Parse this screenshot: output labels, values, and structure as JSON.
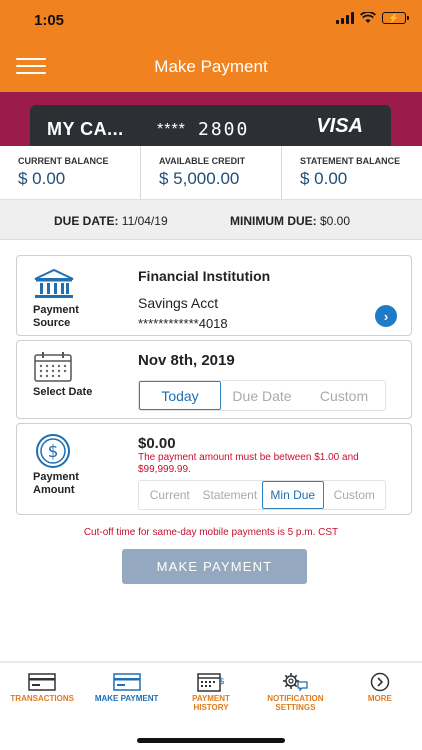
{
  "status_bar": {
    "time": "1:05",
    "battery": "⚡"
  },
  "header": {
    "title": "Make Payment"
  },
  "card": {
    "name": "MY CA...",
    "mask": "****",
    "last4": "2800",
    "brand": "VISA"
  },
  "balances": [
    {
      "label": "CURRENT BALANCE",
      "value": "$ 0.00"
    },
    {
      "label": "AVAILABLE CREDIT",
      "value": "$ 5,000.00"
    },
    {
      "label": "STATEMENT BALANCE",
      "value": "$ 0.00"
    }
  ],
  "due": {
    "due_label": "DUE DATE:",
    "due_value": "11/04/19",
    "min_label": "MINIMUM DUE:",
    "min_value": "$0.00"
  },
  "payment_source": {
    "label_line1": "Payment",
    "label_line2": "Source",
    "institution": "Financial Institution",
    "account": "Savings Acct",
    "account_number": "************4018",
    "icon": "bank-icon"
  },
  "select_date": {
    "label": "Select Date",
    "date": "Nov 8th, 2019",
    "options": [
      "Today",
      "Due Date",
      "Custom"
    ],
    "selected": "Today",
    "icon": "calendar-icon"
  },
  "payment_amount": {
    "label_line1": "Payment",
    "label_line2": "Amount",
    "amount": "$0.00",
    "error": "The payment amount must be between $1.00 and $99,999.99.",
    "options": [
      "Current",
      "Statement",
      "Min Due",
      "Custom"
    ],
    "selected": "Min Due",
    "icon": "dollar-icon"
  },
  "cutoff_notice": "Cut-off time for same-day mobile payments is 5 p.m. CST",
  "make_payment_button": "MAKE PAYMENT",
  "bottom_nav": [
    {
      "label_line1": "TRANSACTIONS",
      "label_line2": "",
      "icon": "card-list-icon"
    },
    {
      "label_line1": "MAKE PAYMENT",
      "label_line2": "",
      "icon": "card-icon",
      "selected": true
    },
    {
      "label_line1": "PAYMENT",
      "label_line2": "HISTORY",
      "icon": "calendar-dollar-icon"
    },
    {
      "label_line1": "NOTIFICATION",
      "label_line2": "SETTINGS",
      "icon": "gear-chat-icon"
    },
    {
      "label_line1": "MORE",
      "label_line2": "",
      "icon": "chevron-circle-icon"
    }
  ],
  "colors": {
    "header": "#F0821F",
    "banner": "#9B1C4A",
    "accent_blue": "#1F4E79",
    "nav_orange": "#E07B1B",
    "error_red": "#C8102E",
    "button": "#94A9BF"
  }
}
